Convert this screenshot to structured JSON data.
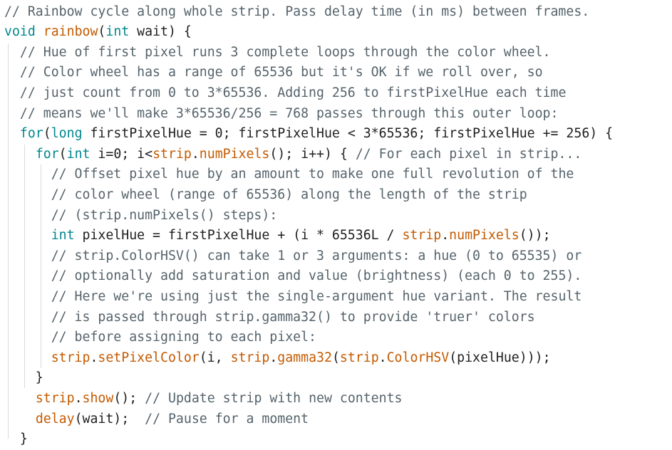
{
  "editor": {
    "lines": [
      [
        {
          "c": "cm",
          "t": "// Rainbow cycle along whole strip. Pass delay time (in ms) between frames."
        }
      ],
      [
        {
          "c": "kw",
          "t": "void"
        },
        {
          "c": "tx",
          "t": " "
        },
        {
          "c": "fn",
          "t": "rainbow"
        },
        {
          "c": "tx",
          "t": "("
        },
        {
          "c": "kw",
          "t": "int"
        },
        {
          "c": "tx",
          "t": " wait) {"
        }
      ],
      [
        {
          "c": "tx",
          "t": "  "
        },
        {
          "c": "cm",
          "t": "// Hue of first pixel runs 3 complete loops through the color wheel."
        }
      ],
      [
        {
          "c": "tx",
          "t": "  "
        },
        {
          "c": "cm",
          "t": "// Color wheel has a range of 65536 but it's OK if we roll over, so"
        }
      ],
      [
        {
          "c": "tx",
          "t": "  "
        },
        {
          "c": "cm",
          "t": "// just count from 0 to 3*65536. Adding 256 to firstPixelHue each time"
        }
      ],
      [
        {
          "c": "tx",
          "t": "  "
        },
        {
          "c": "cm",
          "t": "// means we'll make 3*65536/256 = 768 passes through this outer loop:"
        }
      ],
      [
        {
          "c": "tx",
          "t": "  "
        },
        {
          "c": "kw",
          "t": "for"
        },
        {
          "c": "tx",
          "t": "("
        },
        {
          "c": "kw",
          "t": "long"
        },
        {
          "c": "tx",
          "t": " firstPixelHue = 0; firstPixelHue < 3*65536; firstPixelHue += 256) {"
        }
      ],
      [
        {
          "c": "tx",
          "t": "    "
        },
        {
          "c": "kw",
          "t": "for"
        },
        {
          "c": "tx",
          "t": "("
        },
        {
          "c": "kw",
          "t": "int"
        },
        {
          "c": "tx",
          "t": " i=0; i<"
        },
        {
          "c": "fn",
          "t": "strip"
        },
        {
          "c": "tx",
          "t": "."
        },
        {
          "c": "fn",
          "t": "numPixels"
        },
        {
          "c": "tx",
          "t": "(); i++) { "
        },
        {
          "c": "cm",
          "t": "// For each pixel in strip..."
        }
      ],
      [
        {
          "c": "tx",
          "t": "      "
        },
        {
          "c": "cm",
          "t": "// Offset pixel hue by an amount to make one full revolution of the"
        }
      ],
      [
        {
          "c": "tx",
          "t": "      "
        },
        {
          "c": "cm",
          "t": "// color wheel (range of 65536) along the length of the strip"
        }
      ],
      [
        {
          "c": "tx",
          "t": "      "
        },
        {
          "c": "cm",
          "t": "// (strip.numPixels() steps):"
        }
      ],
      [
        {
          "c": "tx",
          "t": "      "
        },
        {
          "c": "kw",
          "t": "int"
        },
        {
          "c": "tx",
          "t": " pixelHue = firstPixelHue + (i * 65536L / "
        },
        {
          "c": "fn",
          "t": "strip"
        },
        {
          "c": "tx",
          "t": "."
        },
        {
          "c": "fn",
          "t": "numPixels"
        },
        {
          "c": "tx",
          "t": "());"
        }
      ],
      [
        {
          "c": "tx",
          "t": "      "
        },
        {
          "c": "cm",
          "t": "// strip.ColorHSV() can take 1 or 3 arguments: a hue (0 to 65535) or"
        }
      ],
      [
        {
          "c": "tx",
          "t": "      "
        },
        {
          "c": "cm",
          "t": "// optionally add saturation and value (brightness) (each 0 to 255)."
        }
      ],
      [
        {
          "c": "tx",
          "t": "      "
        },
        {
          "c": "cm",
          "t": "// Here we're using just the single-argument hue variant. The result"
        }
      ],
      [
        {
          "c": "tx",
          "t": "      "
        },
        {
          "c": "cm",
          "t": "// is passed through strip.gamma32() to provide 'truer' colors"
        }
      ],
      [
        {
          "c": "tx",
          "t": "      "
        },
        {
          "c": "cm",
          "t": "// before assigning to each pixel:"
        }
      ],
      [
        {
          "c": "tx",
          "t": "      "
        },
        {
          "c": "fn",
          "t": "strip"
        },
        {
          "c": "tx",
          "t": "."
        },
        {
          "c": "fn",
          "t": "setPixelColor"
        },
        {
          "c": "tx",
          "t": "(i, "
        },
        {
          "c": "fn",
          "t": "strip"
        },
        {
          "c": "tx",
          "t": "."
        },
        {
          "c": "fn",
          "t": "gamma32"
        },
        {
          "c": "tx",
          "t": "("
        },
        {
          "c": "fn",
          "t": "strip"
        },
        {
          "c": "tx",
          "t": "."
        },
        {
          "c": "fn",
          "t": "ColorHSV"
        },
        {
          "c": "tx",
          "t": "(pixelHue)));"
        }
      ],
      [
        {
          "c": "tx",
          "t": "    }"
        }
      ],
      [
        {
          "c": "tx",
          "t": "    "
        },
        {
          "c": "fn",
          "t": "strip"
        },
        {
          "c": "tx",
          "t": "."
        },
        {
          "c": "fn",
          "t": "show"
        },
        {
          "c": "tx",
          "t": "(); "
        },
        {
          "c": "cm",
          "t": "// Update strip with new contents"
        }
      ],
      [
        {
          "c": "tx",
          "t": "    "
        },
        {
          "c": "fn",
          "t": "delay"
        },
        {
          "c": "tx",
          "t": "(wait);  "
        },
        {
          "c": "cm",
          "t": "// Pause for a moment"
        }
      ],
      [
        {
          "c": "tx",
          "t": "  }"
        }
      ]
    ]
  },
  "colors": {
    "background": "#ffffff",
    "comment": "#55636b",
    "keyword": "#00878f",
    "function": "#c45a00",
    "text": "#1f1f1f",
    "indent_guide": "#d9d9d9"
  }
}
